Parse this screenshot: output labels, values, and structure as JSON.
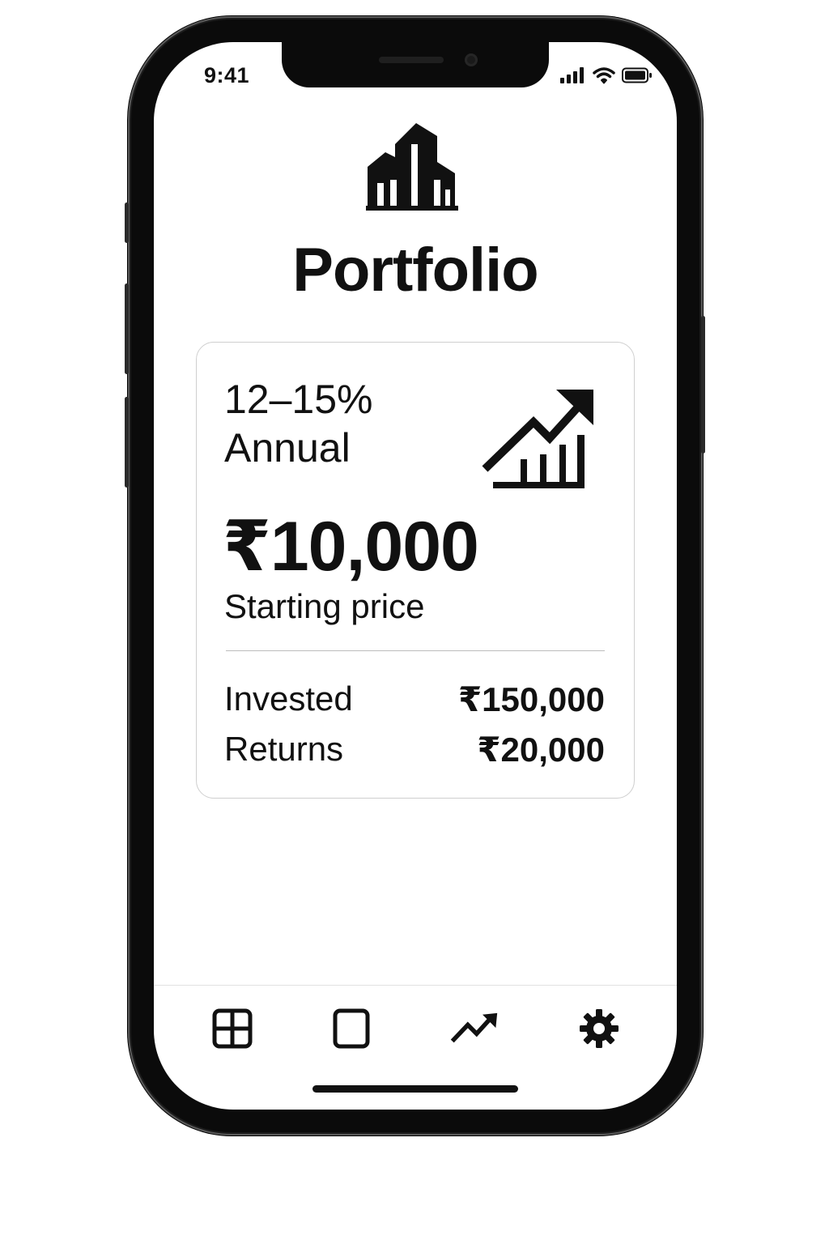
{
  "status_bar": {
    "time": "9:41",
    "icons": [
      "cellular-signal-icon",
      "wifi-icon",
      "battery-icon"
    ]
  },
  "header": {
    "logo_icon": "buildings-icon",
    "title": "Portfolio"
  },
  "card": {
    "rate": "12–15%",
    "period": "Annual",
    "growth_icon": "growth-chart-icon",
    "price": "₹10,000",
    "price_label": "Starting price",
    "stats": [
      {
        "label": "Invested",
        "value": "₹150,000"
      },
      {
        "label": "Returns",
        "value": "₹20,000"
      }
    ]
  },
  "tab_bar": {
    "tabs": [
      {
        "icon": "grid-icon"
      },
      {
        "icon": "square-icon"
      },
      {
        "icon": "trend-icon"
      },
      {
        "icon": "gear-icon"
      }
    ]
  },
  "colors": {
    "text": "#111111",
    "background": "#ffffff",
    "card_border": "#cfcfcf",
    "frame": "#1c1c1c"
  }
}
